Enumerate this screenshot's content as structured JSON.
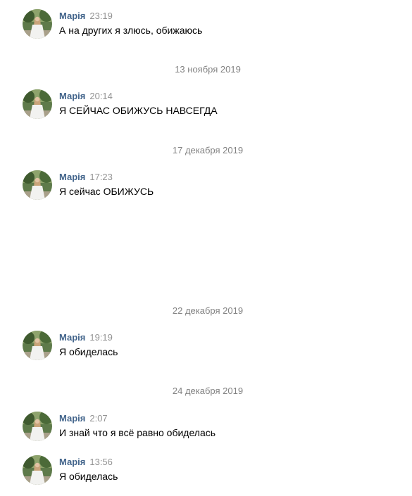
{
  "messages": [
    {
      "author": "Марія",
      "time": "23:19",
      "text": "А на других я злюсь, обижаюсь"
    },
    {
      "author": "Марія",
      "time": "20:14",
      "text": "Я СЕЙЧАС ОБИЖУСЬ НАВСЕГДА"
    },
    {
      "author": "Марія",
      "time": "17:23",
      "text": "Я сейчас ОБИЖУСЬ"
    },
    {
      "author": "Марія",
      "time": "19:19",
      "text": "Я обиделась"
    },
    {
      "author": "Марія",
      "time": "2:07",
      "text": "И знай что я всё равно обиделась"
    },
    {
      "author": "Марія",
      "time": "13:56",
      "text": "Я обиделась"
    }
  ],
  "date_separators": [
    "13 ноября 2019",
    "17 декабря 2019",
    "22 декабря 2019",
    "24 декабря 2019"
  ],
  "colors": {
    "author": "#42648b",
    "time": "#939393",
    "date_separator": "#828282"
  }
}
